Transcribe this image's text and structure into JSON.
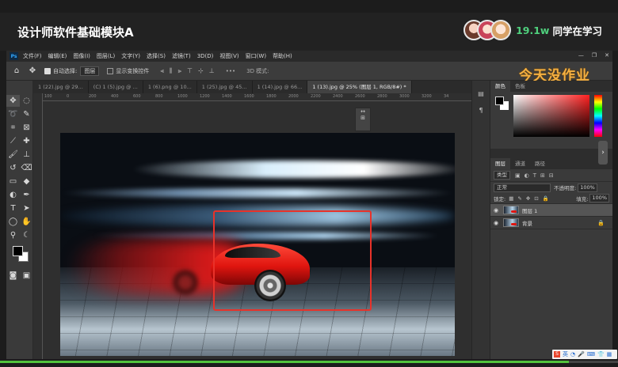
{
  "course": {
    "title": "设计师软件基础模块A",
    "learner_count": "19.1w",
    "learner_label": "同学在学习"
  },
  "menubar": {
    "logo": "Ps",
    "items": [
      "文件(F)",
      "编辑(E)",
      "图像(I)",
      "图层(L)",
      "文字(Y)",
      "选择(S)",
      "滤镜(T)",
      "3D(D)",
      "视图(V)",
      "窗口(W)",
      "帮助(H)"
    ],
    "window_controls": [
      "—",
      "❐",
      "✕"
    ]
  },
  "options_bar": {
    "auto_select_label": "自动选择:",
    "auto_select_value": "图层",
    "show_transform_label": "显示变换控件",
    "mode_3d_label": "3D 模式:",
    "more_label": "•••"
  },
  "watermark": "今天没作业",
  "doc_tabs": [
    {
      "label": "1 (22).jpg @ 29...",
      "active": false
    },
    {
      "label": "(C) 1 (5).jpg @ ...",
      "active": false
    },
    {
      "label": "1 (6).png @ 10...",
      "active": false
    },
    {
      "label": "1 (25).jpg @ 45...",
      "active": false
    },
    {
      "label": "1 (14).jpg @ 66...",
      "active": false
    },
    {
      "label": "1 (13).jpg @ 25% (图层 1, RGB/8#) *",
      "active": true
    }
  ],
  "ruler_ticks": [
    "100",
    "0",
    "200",
    "400",
    "600",
    "800",
    "1000",
    "1200",
    "1400",
    "1600",
    "1800",
    "2000",
    "2200",
    "2400",
    "2600",
    "2800",
    "3000",
    "3200",
    "34"
  ],
  "color_panel": {
    "tabs": [
      "颜色",
      "色板"
    ]
  },
  "layers_panel": {
    "tabs": [
      "图层",
      "通道",
      "路径"
    ],
    "filter_kind": "类型",
    "blend_mode": "正常",
    "opacity_label": "不透明度:",
    "opacity_value": "100%",
    "lock_label": "锁定:",
    "fill_label": "填充:",
    "fill_value": "100%",
    "layers": [
      {
        "name": "图层 1",
        "selected": true,
        "locked": false
      },
      {
        "name": "背景",
        "selected": false,
        "locked": true
      }
    ]
  },
  "ime": {
    "logo": "S",
    "lang": "英"
  },
  "progress": {
    "fraction": 0.92
  },
  "colors": {
    "accent_green": "#4fd07d",
    "selection_red": "#e8322a",
    "watermark_orange": "#f5b041"
  }
}
